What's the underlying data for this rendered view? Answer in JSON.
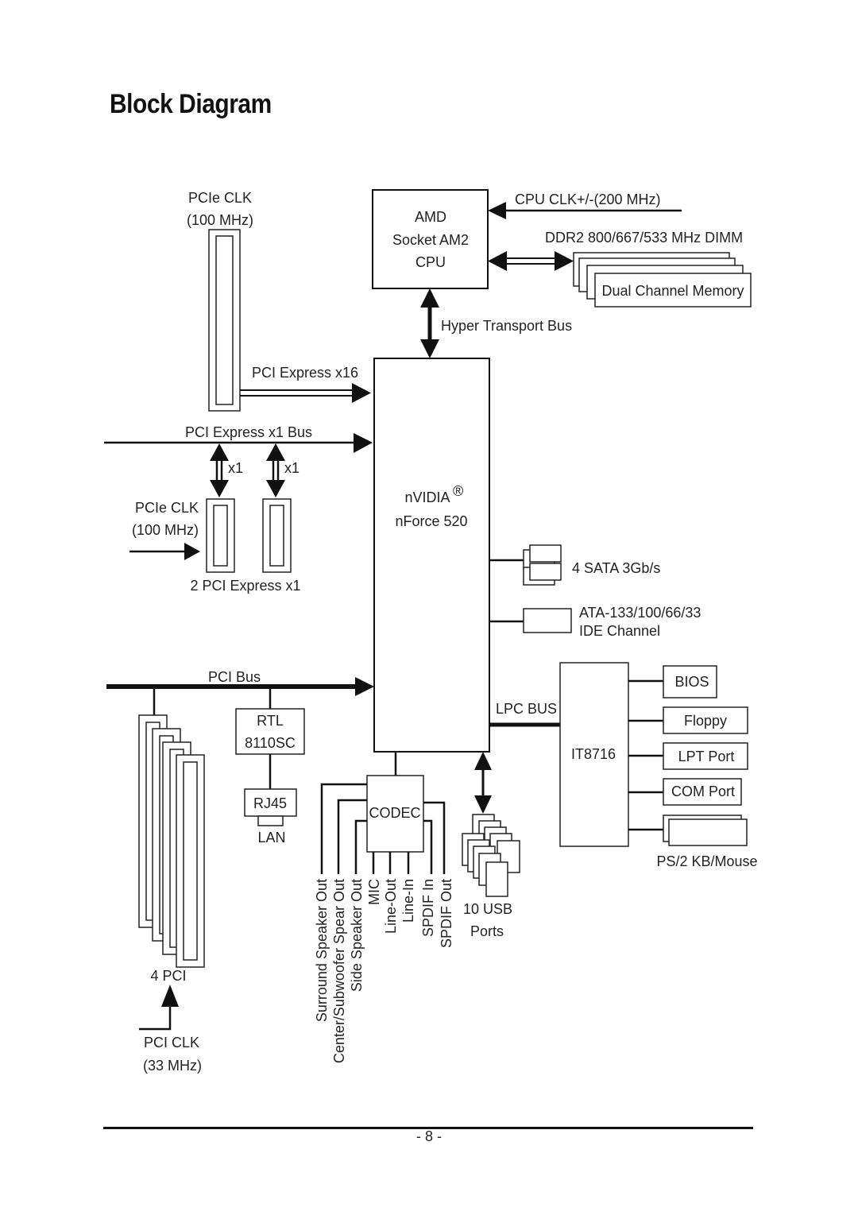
{
  "page": {
    "title": "Block Diagram",
    "page_number": "- 8 -"
  },
  "cpu": {
    "line1": "AMD",
    "line2": "Socket AM2",
    "line3": "CPU",
    "clock_label": "CPU CLK+/-(200 MHz)"
  },
  "memory": {
    "dimm_label": "DDR2 800/667/533 MHz DIMM",
    "box_label": "Dual Channel Memory"
  },
  "hyper_transport": {
    "label": "Hyper Transport Bus"
  },
  "pcie_x16": {
    "clk_line1": "PCIe CLK",
    "clk_line2": "(100 MHz)",
    "bus_label": "PCI Express x16"
  },
  "pcie_x1": {
    "bus_label": "PCI Express x1 Bus",
    "lane1": "x1",
    "lane2": "x1",
    "clk_line1": "PCIe CLK",
    "clk_line2": "(100 MHz)",
    "slots_label": "2 PCI Express x1"
  },
  "chipset": {
    "brand": "nVIDIA",
    "reg_mark": "®",
    "model": "nForce 520"
  },
  "sata": {
    "label": "4 SATA 3Gb/s"
  },
  "ide": {
    "line1": "ATA-133/100/66/33",
    "line2": "IDE Channel"
  },
  "pci": {
    "bus_label": "PCI Bus",
    "slots_label": "4 PCI",
    "clk_line1": "PCI CLK",
    "clk_line2": "(33 MHz)"
  },
  "lan": {
    "chip_line1": "RTL",
    "chip_line2": "8110SC",
    "connector": "RJ45",
    "label": "LAN"
  },
  "audio": {
    "codec": "CODEC",
    "outputs": [
      "Surround Speaker Out",
      "Center/Subwoofer Spear Out",
      "Side Speaker Out",
      "MIC",
      "Line-Out",
      "Line-In",
      "SPDIF In",
      "SPDIF Out"
    ]
  },
  "usb": {
    "line1": "10 USB",
    "line2": "Ports"
  },
  "superio": {
    "lpc_label": "LPC BUS",
    "chip": "IT8716",
    "bios": "BIOS",
    "floppy": "Floppy",
    "lpt": "LPT Port",
    "com": "COM Port",
    "ps2": "PS/2 KB/Mouse"
  }
}
